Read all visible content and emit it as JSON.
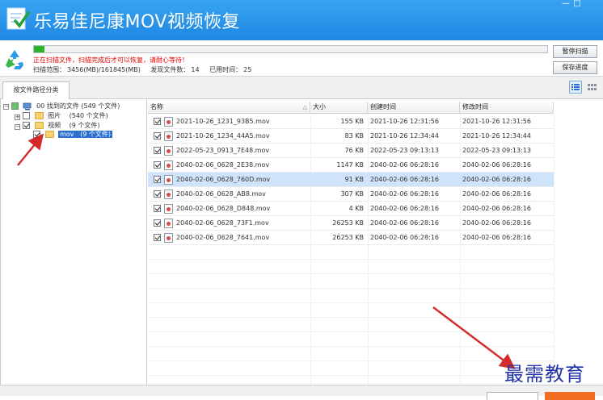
{
  "app": {
    "title": "乐易佳尼康MOV视频恢复",
    "window_controls": [
      "—",
      "□"
    ]
  },
  "scan": {
    "progress_percent": 2,
    "message": "正在扫描文件，扫描完成后才可以恢复，请耐心等待！",
    "range_label": "扫描范围：",
    "range_value": "3456(MB)/161845(MB)",
    "found_label": "发现文件数：",
    "found_value": "14",
    "time_label": "已用时间：",
    "time_value": "25",
    "pause_button": "暂停扫描",
    "save_button": "保存进度"
  },
  "tabs": {
    "active": "按文件路径分类"
  },
  "tree": {
    "root": "00 找到的文件 (549 个文件)",
    "items": [
      {
        "label": "图片",
        "count": "(540 个文件)"
      },
      {
        "label": "视频",
        "count": "(9 个文件)"
      }
    ],
    "child": {
      "label": "mov",
      "count": "(9 个文件)"
    }
  },
  "table": {
    "columns": {
      "name": "名称",
      "size": "大小",
      "created": "创建时间",
      "modified": "修改时间"
    },
    "rows": [
      {
        "name": "2021-10-26_1231_93B5.mov",
        "size": "155 KB",
        "created": "2021-10-26  12:31:56",
        "modified": "2021-10-26  12:31:56",
        "selected": false
      },
      {
        "name": "2021-10-26_1234_44A5.mov",
        "size": "83 KB",
        "created": "2021-10-26  12:34:44",
        "modified": "2021-10-26  12:34:44",
        "selected": false
      },
      {
        "name": "2022-05-23_0913_7E48.mov",
        "size": "76 KB",
        "created": "2022-05-23  09:13:13",
        "modified": "2022-05-23  09:13:13",
        "selected": false
      },
      {
        "name": "2040-02-06_0628_2E38.mov",
        "size": "1147 KB",
        "created": "2040-02-06  06:28:16",
        "modified": "2040-02-06  06:28:16",
        "selected": false
      },
      {
        "name": "2040-02-06_0628_760D.mov",
        "size": "91 KB",
        "created": "2040-02-06  06:28:16",
        "modified": "2040-02-06  06:28:16",
        "selected": true
      },
      {
        "name": "2040-02-06_0628_AB8.mov",
        "size": "307 KB",
        "created": "2040-02-06  06:28:16",
        "modified": "2040-02-06  06:28:16",
        "selected": false
      },
      {
        "name": "2040-02-06_0628_D848.mov",
        "size": "4 KB",
        "created": "2040-02-06  06:28:16",
        "modified": "2040-02-06  06:28:16",
        "selected": false
      },
      {
        "name": "2040-02-06_0628_73F1.mov",
        "size": "26253 KB",
        "created": "2040-02-06  06:28:16",
        "modified": "2040-02-06  06:28:16",
        "selected": false
      },
      {
        "name": "2040-02-06_0628_7641.mov",
        "size": "26253 KB",
        "created": "2040-02-06  06:28:16",
        "modified": "2040-02-06  06:28:16",
        "selected": false
      }
    ]
  },
  "watermark": "最需教育",
  "colors": {
    "title_bar": "#1e88e5",
    "progress": "#2ab52a",
    "alert_text": "#e00000",
    "selection": "#cfe4fb",
    "annotation_arrow": "#d42a2a",
    "watermark": "#2233aa"
  }
}
